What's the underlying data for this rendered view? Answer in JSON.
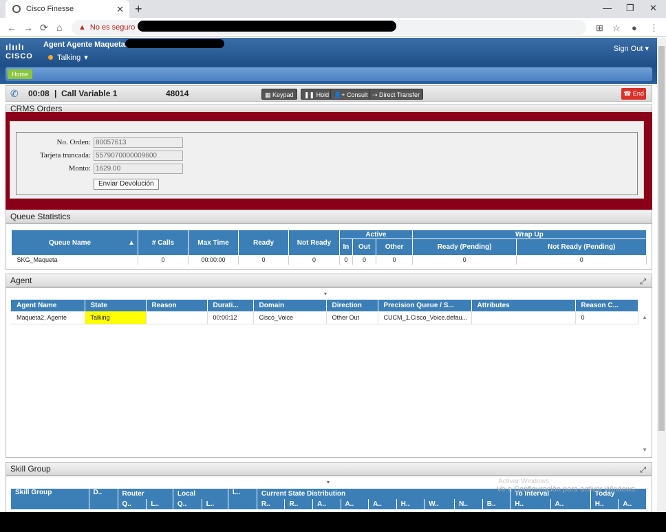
{
  "browser": {
    "tab_title": "Cisco Finesse",
    "security_label": "No es seguro"
  },
  "header": {
    "agent_name": "Agent Agente Maqueta.",
    "state": "Talking",
    "sign_out": "Sign Out",
    "home": "Home",
    "logo_text": "CISCO"
  },
  "call": {
    "timer": "00:08",
    "label": "Call Variable 1",
    "number": "48014",
    "keypad": "Keypad",
    "hold": "Hold",
    "consult": "Consult",
    "direct_transfer": "Direct Transfer",
    "end": "End"
  },
  "orders": {
    "title": "CRMS Orders",
    "fields": [
      {
        "label": "No. Orden:",
        "value": "80057613"
      },
      {
        "label": "Tarjeta truncada:",
        "value": "5579070000009600"
      },
      {
        "label": "Monto:",
        "value": "1629.00"
      }
    ],
    "button": "Enviar Devolución"
  },
  "queue_stats": {
    "title": "Queue Statistics",
    "headers": [
      "Queue Name",
      "# Calls",
      "Max Time",
      "Ready",
      "Not Ready"
    ],
    "group_active": "Active",
    "group_wrapup": "Wrap Up",
    "sub_headers": [
      "In",
      "Out",
      "Other",
      "Ready (Pending)",
      "Not Ready (Pending)"
    ],
    "rows": [
      [
        "SKG_Maqueta",
        "0",
        "00:00:00",
        "0",
        "0",
        "0",
        "0",
        "0",
        "0",
        "0"
      ]
    ]
  },
  "agent": {
    "title": "Agent",
    "headers": [
      "Agent Name",
      "State",
      "Reason",
      "Durati...",
      "Domain",
      "Direction",
      "Precision Queue / S...",
      "Attributes",
      "Reason C..."
    ],
    "rows": [
      [
        "Maqueta2, Agente",
        "Talking",
        "",
        "00:00:12",
        "Cisco_Voice",
        "Other Out",
        "CUCM_1.Cisco_Voice.defau...",
        "",
        "0"
      ]
    ],
    "state_color": "#ffff00"
  },
  "skill_group": {
    "title": "Skill Group",
    "headers_top": [
      "Skill Group",
      "D..",
      "Router",
      "Local",
      "L..",
      "Current State Distribution",
      "To Interval",
      "Today"
    ],
    "headers_sub": [
      "Q..",
      "L..",
      "Q..",
      "L..",
      "R..",
      "R..",
      "A..",
      "A..",
      "A..",
      "H..",
      "W..",
      "N..",
      "B..",
      "H..",
      "A..",
      "H..",
      "A.."
    ]
  },
  "watermark": {
    "line1": "Activar Windows",
    "line2": "Ve a Configuración para activar Windows."
  },
  "colors": {
    "header_blue": "#1f4f87",
    "table_blue": "#3b7fb6",
    "orders_red": "#8b0018",
    "end_red": "#d9302a",
    "home_green": "#8cc63f"
  }
}
